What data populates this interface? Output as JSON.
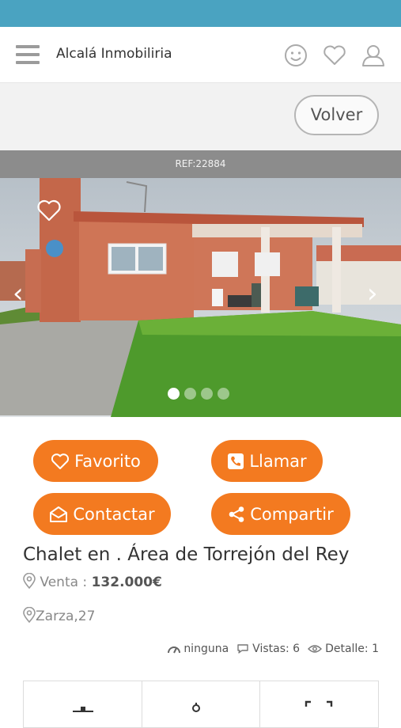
{
  "header": {
    "app_title": "Alcalá Inmobiliria",
    "icons": [
      "menu-icon",
      "smiley-icon",
      "heart-icon",
      "user-icon"
    ]
  },
  "toolbar": {
    "back_label": "Volver"
  },
  "listing": {
    "ref": "REF:22884",
    "carousel": {
      "total_images": 4,
      "active_index": 0
    },
    "title": "Chalet en . Área de Torrejón del Rey",
    "price_prefix": "Venta : ",
    "price": "132.000€",
    "address": "Zarza,27",
    "stats": {
      "energy": "ninguna",
      "views_label": "Vistas: 6",
      "detail_label": "Detalle: 1"
    }
  },
  "actions": {
    "favorite": "Favorito",
    "call": "Llamar",
    "contact": "Contactar",
    "share": "Compartir"
  },
  "colors": {
    "statusbar": "#4aa3c1",
    "accent": "#f37a20",
    "ref_bar": "#8c8c8c"
  }
}
